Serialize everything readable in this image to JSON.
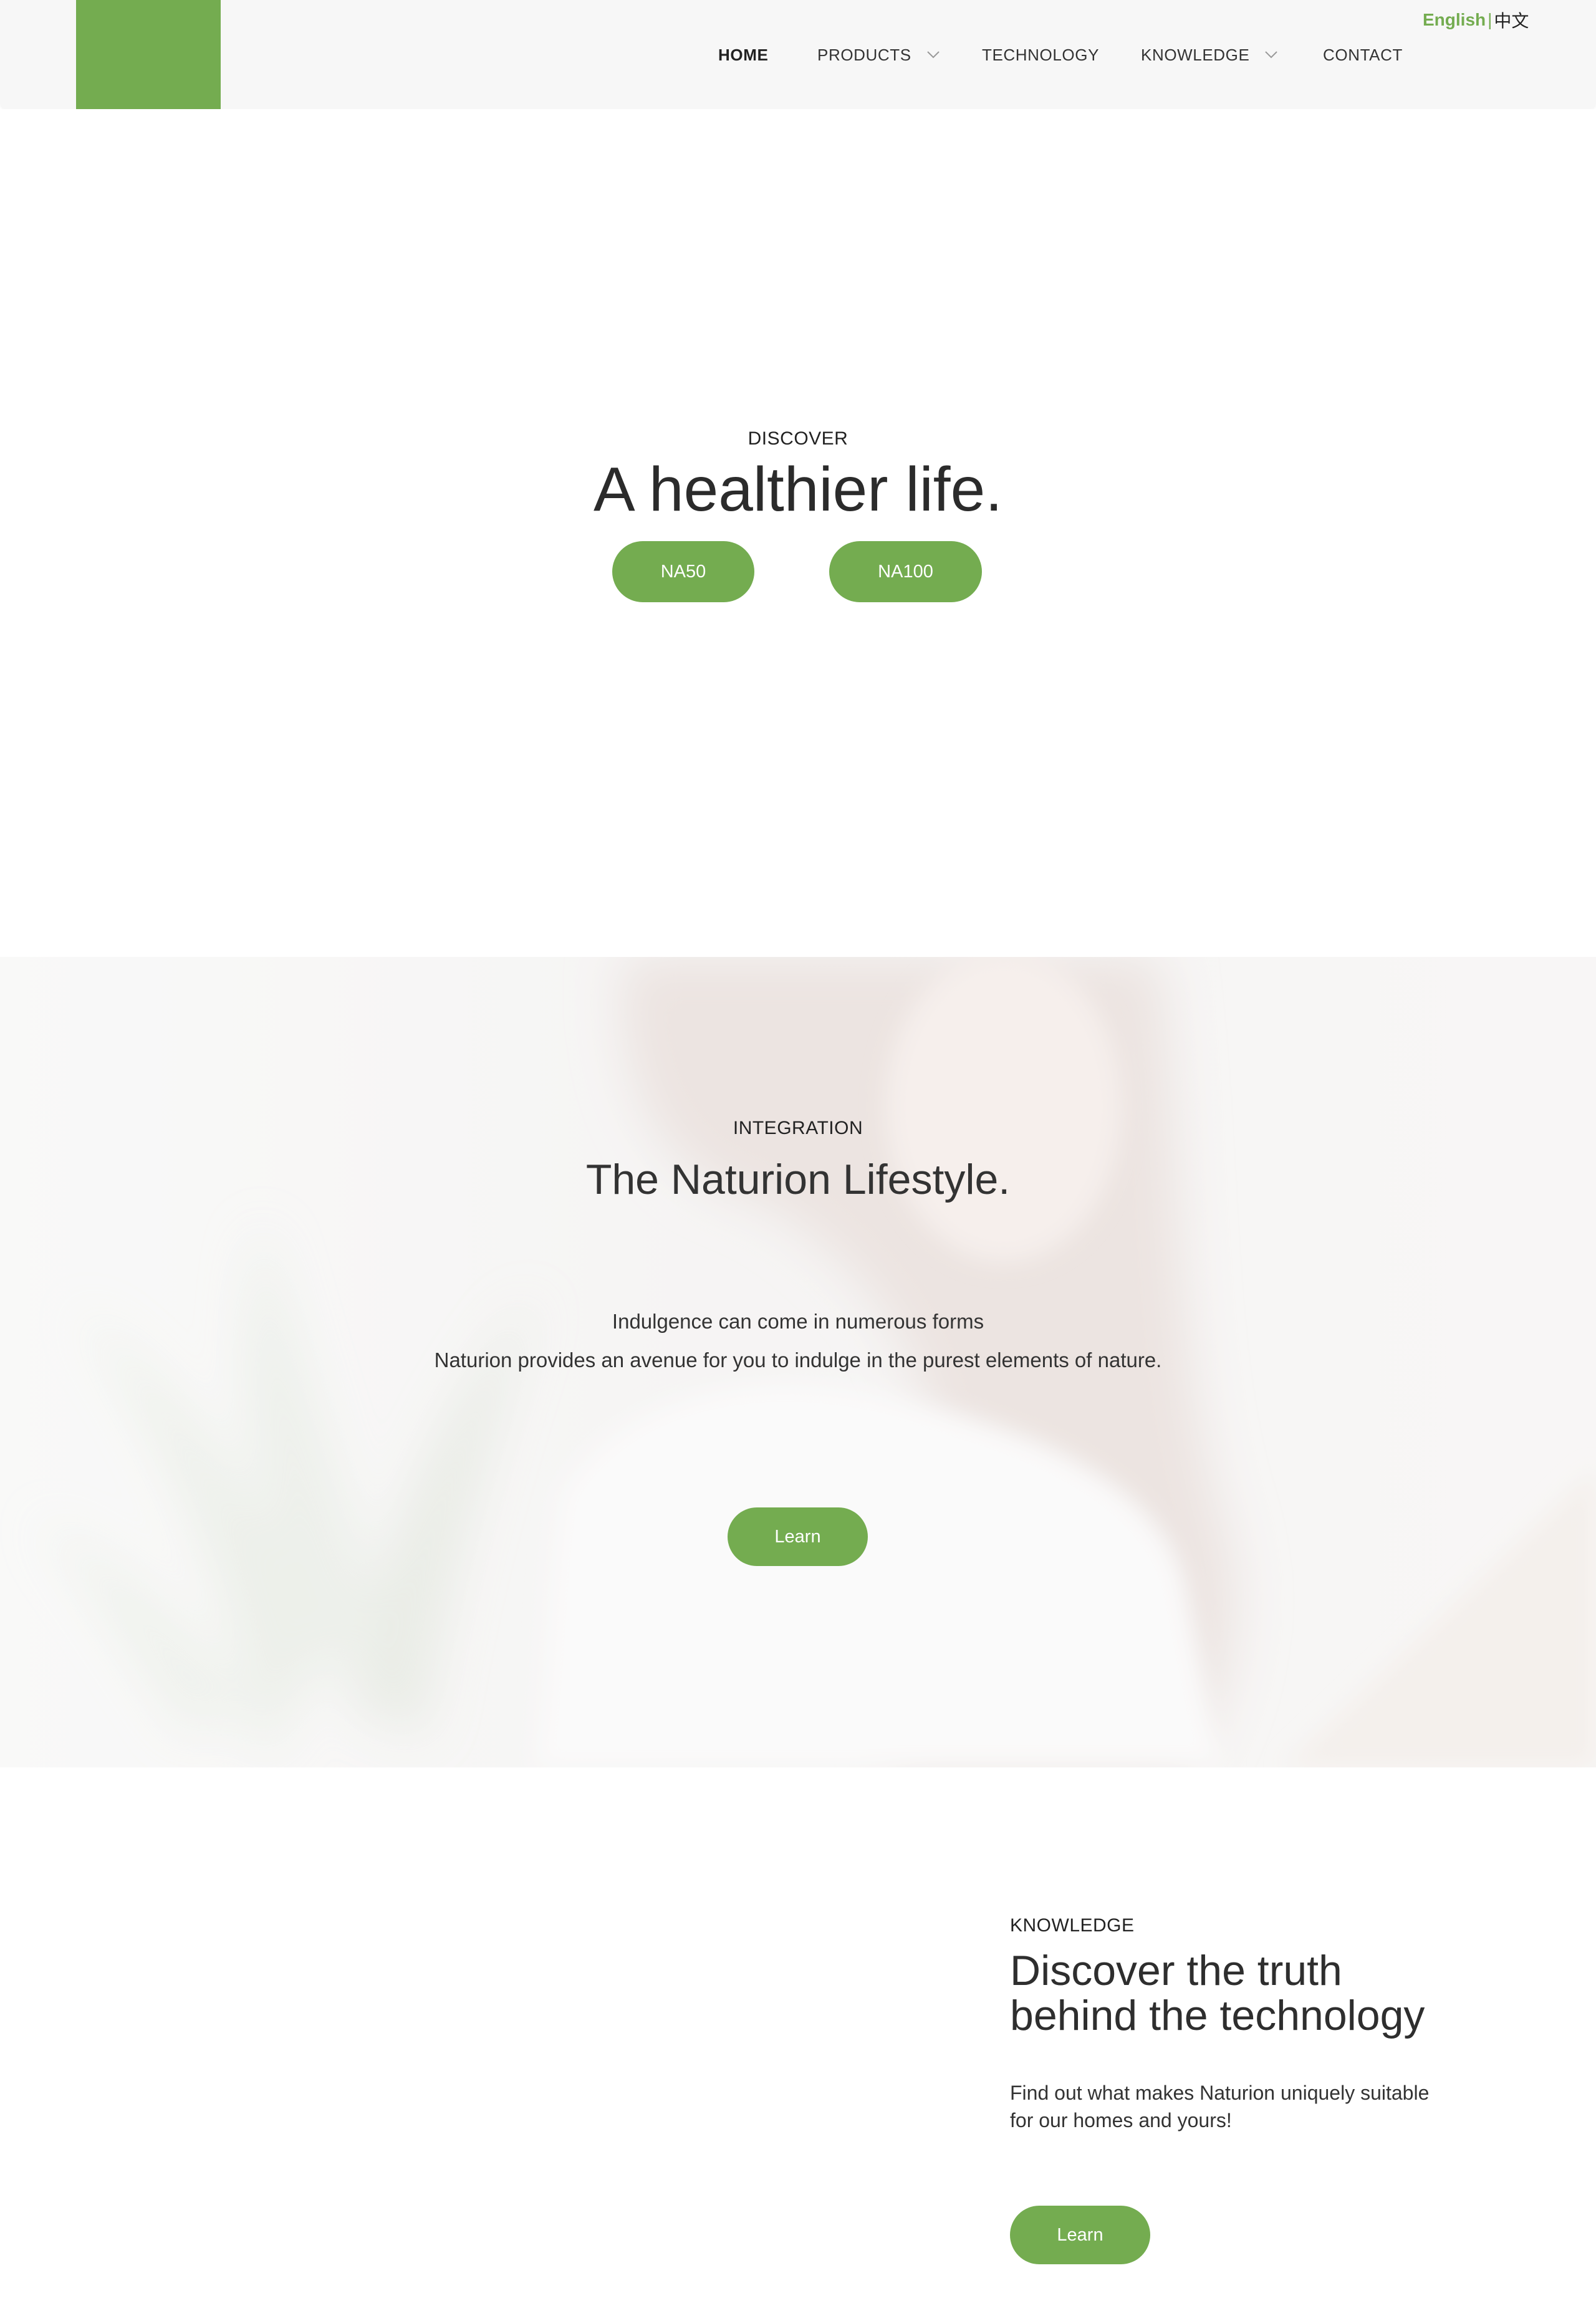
{
  "header": {
    "lang_en": "English",
    "lang_sep": "|",
    "lang_zh": "中文",
    "nav": {
      "home": "HOME",
      "products": "PRODUCTS",
      "technology": "TECHNOLOGY",
      "knowledge": "KNOWLEDGE",
      "contact": "CONTACT"
    },
    "nav_chevron_icon": "chevron-down-icon"
  },
  "hero": {
    "eyebrow": "DISCOVER",
    "title": "A healthier life.",
    "buttons": [
      "NA50",
      "NA100"
    ]
  },
  "lifestyle": {
    "eyebrow": "INTEGRATION",
    "title": "The Naturion Lifestyle.",
    "line1": "Indulgence can come in numerous forms",
    "line2": "Naturion provides an avenue for you to indulge in the purest elements of nature.",
    "button": "Learn"
  },
  "knowledge": {
    "eyebrow": "KNOWLEDGE",
    "title_line1": "Discover the truth",
    "title_line2": "behind the technology",
    "body_line1": "Find out what makes Naturion uniquely suitable",
    "body_line2": "for our homes and yours!",
    "button": "Learn"
  },
  "colors": {
    "accent": "#74ac50",
    "header_bg": "#f7f7f7",
    "text": "#333333"
  }
}
